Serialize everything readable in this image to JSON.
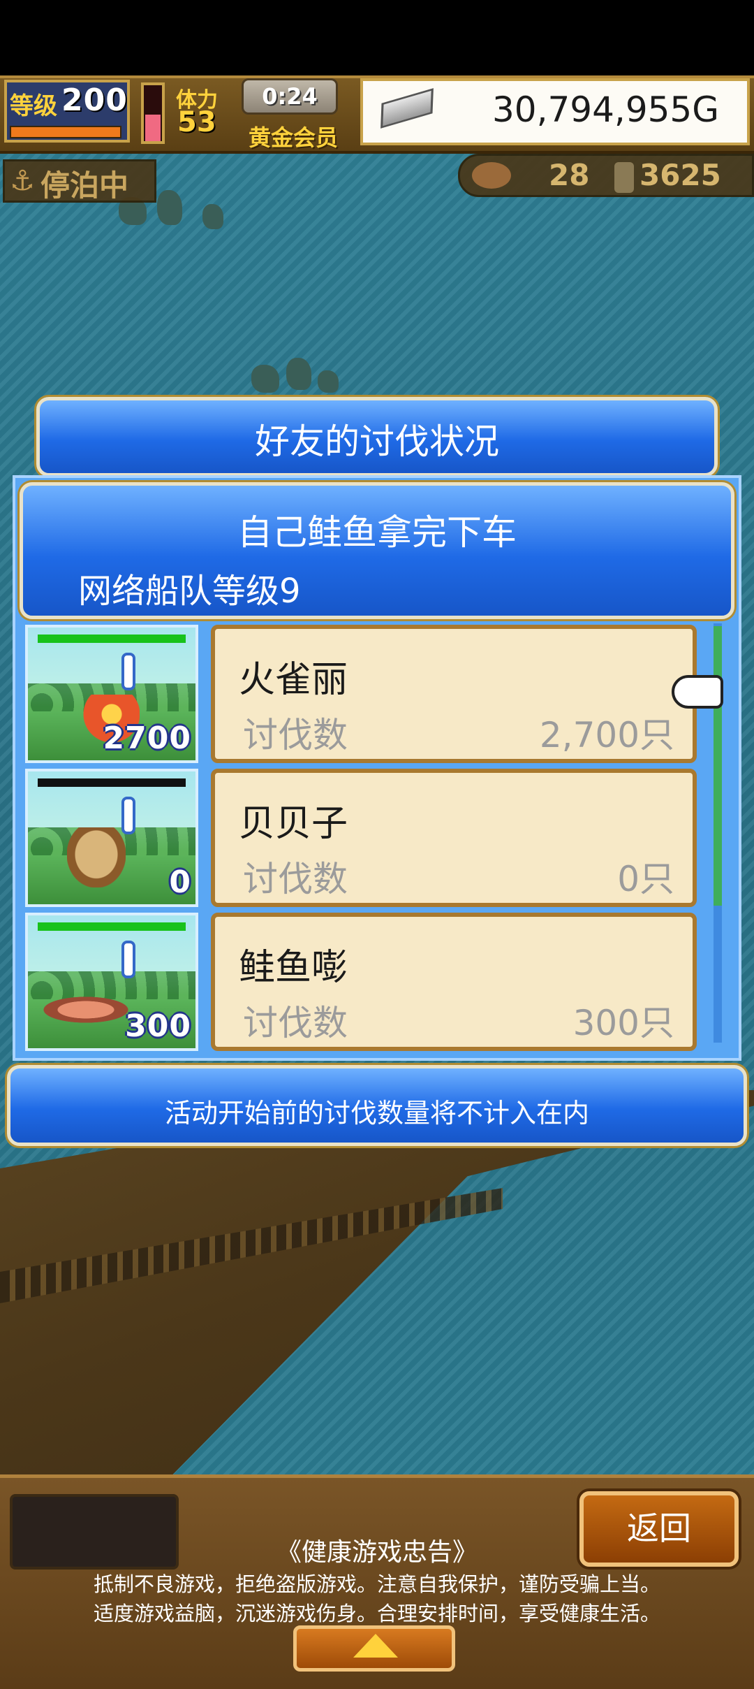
{
  "hud": {
    "level_label": "等级",
    "level": "200",
    "stamina_label": "体力",
    "stamina": "53",
    "timer": "0:24",
    "membership": "黄金会员",
    "gold": "30,794,955G",
    "status": "停泊中",
    "fish_count": "28",
    "coin_count": "3625",
    "colors": {
      "accent": "#ffd23c",
      "hud_bg": "#5a3f14"
    }
  },
  "dialog": {
    "title": "好友的讨伐状况",
    "header_title": "自己鲑鱼拿完下车",
    "header_subtitle": "网络船队等级9",
    "rows": [
      {
        "name": "火雀丽",
        "label": "讨伐数",
        "value": "2,700只",
        "badge": "2700",
        "monster_icon": "fire-bird-icon",
        "hp_color": "#18c21b"
      },
      {
        "name": "贝贝子",
        "label": "讨伐数",
        "value": "0只",
        "badge": "0",
        "monster_icon": "hermit-crab-icon",
        "hp_color": "#111111"
      },
      {
        "name": "鲑鱼嘭",
        "label": "讨伐数",
        "value": "300只",
        "badge": "300",
        "monster_icon": "salmon-icon",
        "hp_color": "#18c21b"
      }
    ],
    "note": "活动开始前的讨伐数量将不计入在内",
    "colors": {
      "banner": "#1f6ae6",
      "card": "#f7e9c7"
    }
  },
  "bottom": {
    "back_label": "返回",
    "advisory_title": "《健康游戏忠告》",
    "advisory_line1": "抵制不良游戏，拒绝盗版游戏。注意自我保护，谨防受骗上当。",
    "advisory_line2": "适度游戏益脑，沉迷游戏伤身。合理安排时间，享受健康生活。"
  }
}
